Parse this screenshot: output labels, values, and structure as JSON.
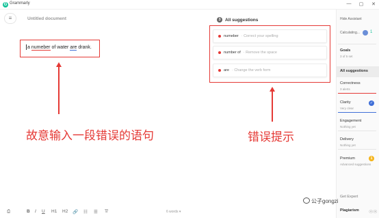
{
  "app": {
    "title": "Grammarly",
    "logo_letter": "G"
  },
  "window_controls": {
    "minimize": "—",
    "maximize": "▢",
    "close": "✕"
  },
  "document": {
    "title": "Untitled document",
    "menu_icon": "≡"
  },
  "editor": {
    "word_a": "a",
    "word_numeber": "numeber",
    "word_of": "of",
    "word_water": "water",
    "word_are": "are",
    "word_drank": "drank."
  },
  "annotations": {
    "left_label": "故意输入一段错误的语句",
    "right_label": "错误提示",
    "color": "#e53935"
  },
  "suggestions": {
    "count": "3",
    "header": "All suggestions",
    "items": [
      {
        "word": "numeber",
        "desc": "· Correct your spelling"
      },
      {
        "word": "number of",
        "desc": "· Remove the space"
      },
      {
        "word": "are",
        "desc": "· Change the verb form"
      }
    ]
  },
  "sidebar": {
    "hide_assistant": "Hide Assistant",
    "calculating": "Calculating...",
    "calc_value": "1",
    "goals": "Goals",
    "goals_sub": "3 of 5 set",
    "all_suggestions": "All suggestions",
    "correctness": "Correctness",
    "correctness_sub": "3 alerts",
    "clarity": "Clarity",
    "clarity_sub": "Very clear",
    "clarity_check": "✓",
    "engagement": "Engagement",
    "engagement_sub": "Nothing yet",
    "delivery": "Delivery",
    "delivery_sub": "Nothing yet",
    "premium": "Premium",
    "premium_sub": "Advanced suggestions",
    "premium_badge": "1",
    "get_expert": "Get Expert",
    "plagiarism": "Plagiarism",
    "plagiarism_icon": "☉☉"
  },
  "toolbar": {
    "save": "⎙",
    "bold": "B",
    "italic": "I",
    "underline": "U",
    "h1": "H1",
    "h2": "H2",
    "link": "🔗",
    "ordered_list": "☷",
    "bullet_list": "☰",
    "clear": "T̸",
    "word_count": "6 words ▾"
  },
  "watermark": {
    "text": "公子gongzi"
  },
  "colors": {
    "accent": "#15c39a",
    "error": "#e53935",
    "clarity": "#3f6fd8",
    "premium": "#f5b41a"
  }
}
